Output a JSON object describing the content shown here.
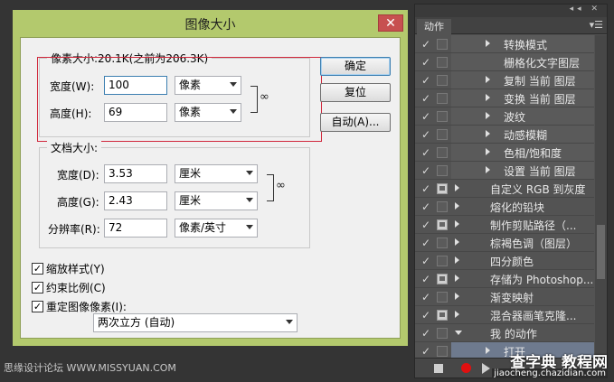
{
  "dialog": {
    "title": "图像大小",
    "close_glyph": "✕",
    "pixel_dims": {
      "legend": "像素大小:20.1K(之前为206.3K)",
      "width_label": "宽度(W):",
      "width_value": "100",
      "width_unit": "像素",
      "height_label": "高度(H):",
      "height_value": "69",
      "height_unit": "像素"
    },
    "doc_size": {
      "legend": "文档大小:",
      "width_label": "宽度(D):",
      "width_value": "3.53",
      "width_unit": "厘米",
      "height_label": "高度(G):",
      "height_value": "2.43",
      "height_unit": "厘米",
      "res_label": "分辨率(R):",
      "res_value": "72",
      "res_unit": "像素/英寸"
    },
    "buttons": {
      "ok": "确定",
      "reset": "复位",
      "auto": "自动(A)..."
    },
    "checkboxes": {
      "scale_styles": "缩放样式(Y)",
      "constrain": "约束比例(C)",
      "resample": "重定图像像素(I):"
    },
    "check_glyph": "✓",
    "resample_method": "两次立方 (自动)",
    "link_glyph": "∞"
  },
  "panel": {
    "tab": "动作",
    "top_controls": "◂◂ ✕",
    "menu_glyph": "▾☰",
    "check_glyph": "✓",
    "items": [
      {
        "label": "转换模式",
        "level": 2,
        "expand": "right",
        "dialog": false
      },
      {
        "label": "栅格化文字图层",
        "level": 2,
        "expand": "none",
        "dialog": false
      },
      {
        "label": "复制 当前 图层",
        "level": 2,
        "expand": "right",
        "dialog": false
      },
      {
        "label": "变换 当前 图层",
        "level": 2,
        "expand": "right",
        "dialog": false
      },
      {
        "label": "波纹",
        "level": 2,
        "expand": "right",
        "dialog": false
      },
      {
        "label": "动感模糊",
        "level": 2,
        "expand": "right",
        "dialog": false
      },
      {
        "label": "色相/饱和度",
        "level": 2,
        "expand": "right",
        "dialog": false
      },
      {
        "label": "设置 当前 图层",
        "level": 2,
        "expand": "right",
        "dialog": false
      },
      {
        "label": "自定义 RGB 到灰度",
        "level": 1,
        "expand": "right",
        "dialog": true
      },
      {
        "label": "熔化的铅块",
        "level": 1,
        "expand": "right",
        "dialog": false
      },
      {
        "label": "制作剪贴路径（...",
        "level": 1,
        "expand": "right",
        "dialog": true
      },
      {
        "label": "棕褐色调（图层）",
        "level": 1,
        "expand": "right",
        "dialog": false
      },
      {
        "label": "四分颜色",
        "level": 1,
        "expand": "right",
        "dialog": false
      },
      {
        "label": "存储为 Photoshop...",
        "level": 1,
        "expand": "right",
        "dialog": true
      },
      {
        "label": "渐变映射",
        "level": 1,
        "expand": "right",
        "dialog": false
      },
      {
        "label": "混合器画笔克隆...",
        "level": 1,
        "expand": "right",
        "dialog": true
      },
      {
        "label": "我 的动作",
        "level": 1,
        "expand": "down",
        "dialog": false
      },
      {
        "label": "打开",
        "level": 2,
        "expand": "right",
        "dialog": false
      }
    ]
  },
  "watermarks": {
    "left": "思缘设计论坛 WWW.MISSYUAN.COM",
    "brand": "查字典 教程网",
    "url": "jiaocheng.chazidian.com"
  }
}
